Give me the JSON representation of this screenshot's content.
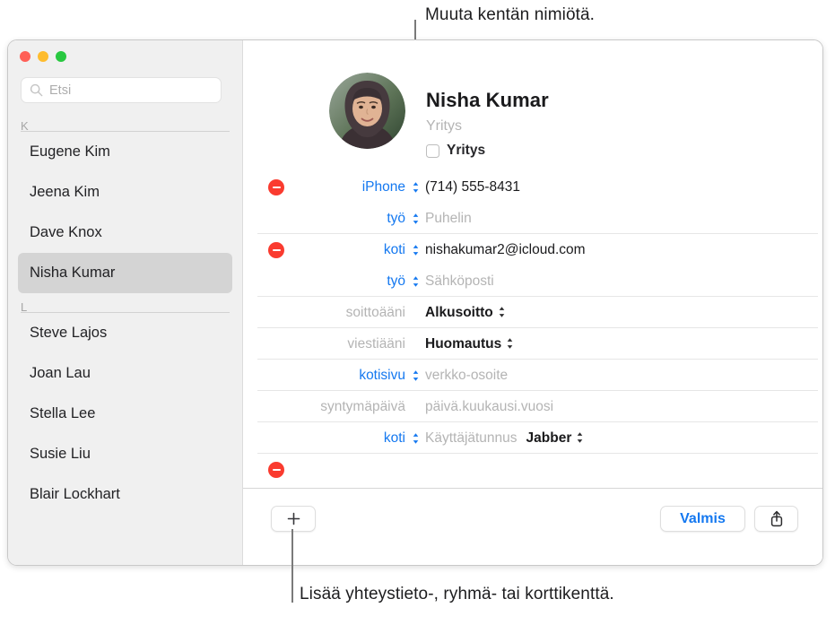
{
  "callouts": {
    "top": "Muuta kentän nimiötä.",
    "bottom": "Lisää yhteystieto-, ryhmä- tai korttikenttä."
  },
  "colors": {
    "accent_blue": "#1478f0",
    "delete_red": "#fa3b2f",
    "sidebar_bg": "#f0f0f0",
    "selection_gray": "#d4d4d4",
    "placeholder_gray": "#b4b4b4",
    "traffic_close": "#ff5f57",
    "traffic_minimize": "#febc2e",
    "traffic_zoom": "#28c840"
  },
  "window": {
    "traffic_lights": [
      {
        "name": "close",
        "color": "#ff5f57"
      },
      {
        "name": "minimize",
        "color": "#febc2e"
      },
      {
        "name": "zoom",
        "color": "#28c840"
      }
    ]
  },
  "sidebar": {
    "search": {
      "icon": "search-icon",
      "placeholder": "Etsi",
      "value": ""
    },
    "sections": [
      {
        "letter": "K",
        "contacts": [
          {
            "name": "Eugene Kim",
            "selected": false
          },
          {
            "name": "Jeena Kim",
            "selected": false
          },
          {
            "name": "Dave Knox",
            "selected": false
          },
          {
            "name": "Nisha Kumar",
            "selected": true
          }
        ]
      },
      {
        "letter": "L",
        "contacts": [
          {
            "name": "Steve Lajos",
            "selected": false
          },
          {
            "name": "Joan Lau",
            "selected": false
          },
          {
            "name": "Stella Lee",
            "selected": false
          },
          {
            "name": "Susie Liu",
            "selected": false
          },
          {
            "name": "Blair Lockhart",
            "selected": false
          }
        ]
      }
    ]
  },
  "card": {
    "name": "Nisha  Kumar",
    "company_placeholder": "Yritys",
    "company_checkbox_label": "Yritys",
    "company_checkbox_checked": false,
    "avatar_alt": "avatar",
    "fields": [
      {
        "id": "phone-iphone",
        "removable": true,
        "label": "iPhone",
        "label_style": "blue",
        "has_stepper": true,
        "value": "(714) 555-8431",
        "value_is_placeholder": false,
        "separator": false
      },
      {
        "id": "phone-work",
        "removable": false,
        "label": "työ",
        "label_style": "blue",
        "has_stepper": true,
        "value": "Puhelin",
        "value_is_placeholder": true,
        "separator": true
      },
      {
        "id": "email-home",
        "removable": true,
        "label": "koti",
        "label_style": "blue",
        "has_stepper": true,
        "value": "nishakumar2@icloud.com",
        "value_is_placeholder": false,
        "separator": false
      },
      {
        "id": "email-work",
        "removable": false,
        "label": "työ",
        "label_style": "blue",
        "has_stepper": true,
        "value": "Sähköposti",
        "value_is_placeholder": true,
        "separator": true
      },
      {
        "id": "ringtone",
        "removable": false,
        "label": "soittoääni",
        "label_style": "gray",
        "has_stepper": false,
        "value": "Alkusoitto",
        "value_is_placeholder": false,
        "value_bold": true,
        "value_stepper": true,
        "separator": true
      },
      {
        "id": "text-tone",
        "removable": false,
        "label": "viestiääni",
        "label_style": "gray",
        "has_stepper": false,
        "value": "Huomautus",
        "value_is_placeholder": false,
        "value_bold": true,
        "value_stepper": true,
        "separator": true
      },
      {
        "id": "homepage",
        "removable": false,
        "label": "kotisivu",
        "label_style": "blue",
        "has_stepper": true,
        "value": "verkko-osoite",
        "value_is_placeholder": true,
        "separator": true
      },
      {
        "id": "birthday",
        "removable": false,
        "label": "syntymäpäivä",
        "label_style": "gray",
        "has_stepper": false,
        "value": "päivä.kuukausi.vuosi",
        "value_is_placeholder": true,
        "separator": true
      },
      {
        "id": "instant-message",
        "removable": false,
        "label": "koti",
        "label_style": "blue",
        "has_stepper": true,
        "value": "Käyttäjätunnus",
        "value_is_placeholder": true,
        "service": "Jabber",
        "service_stepper": true,
        "separator": true
      }
    ]
  },
  "bottom_bar": {
    "add_button_icon": "plus-icon",
    "done_label": "Valmis",
    "share_button_icon": "share-icon"
  }
}
